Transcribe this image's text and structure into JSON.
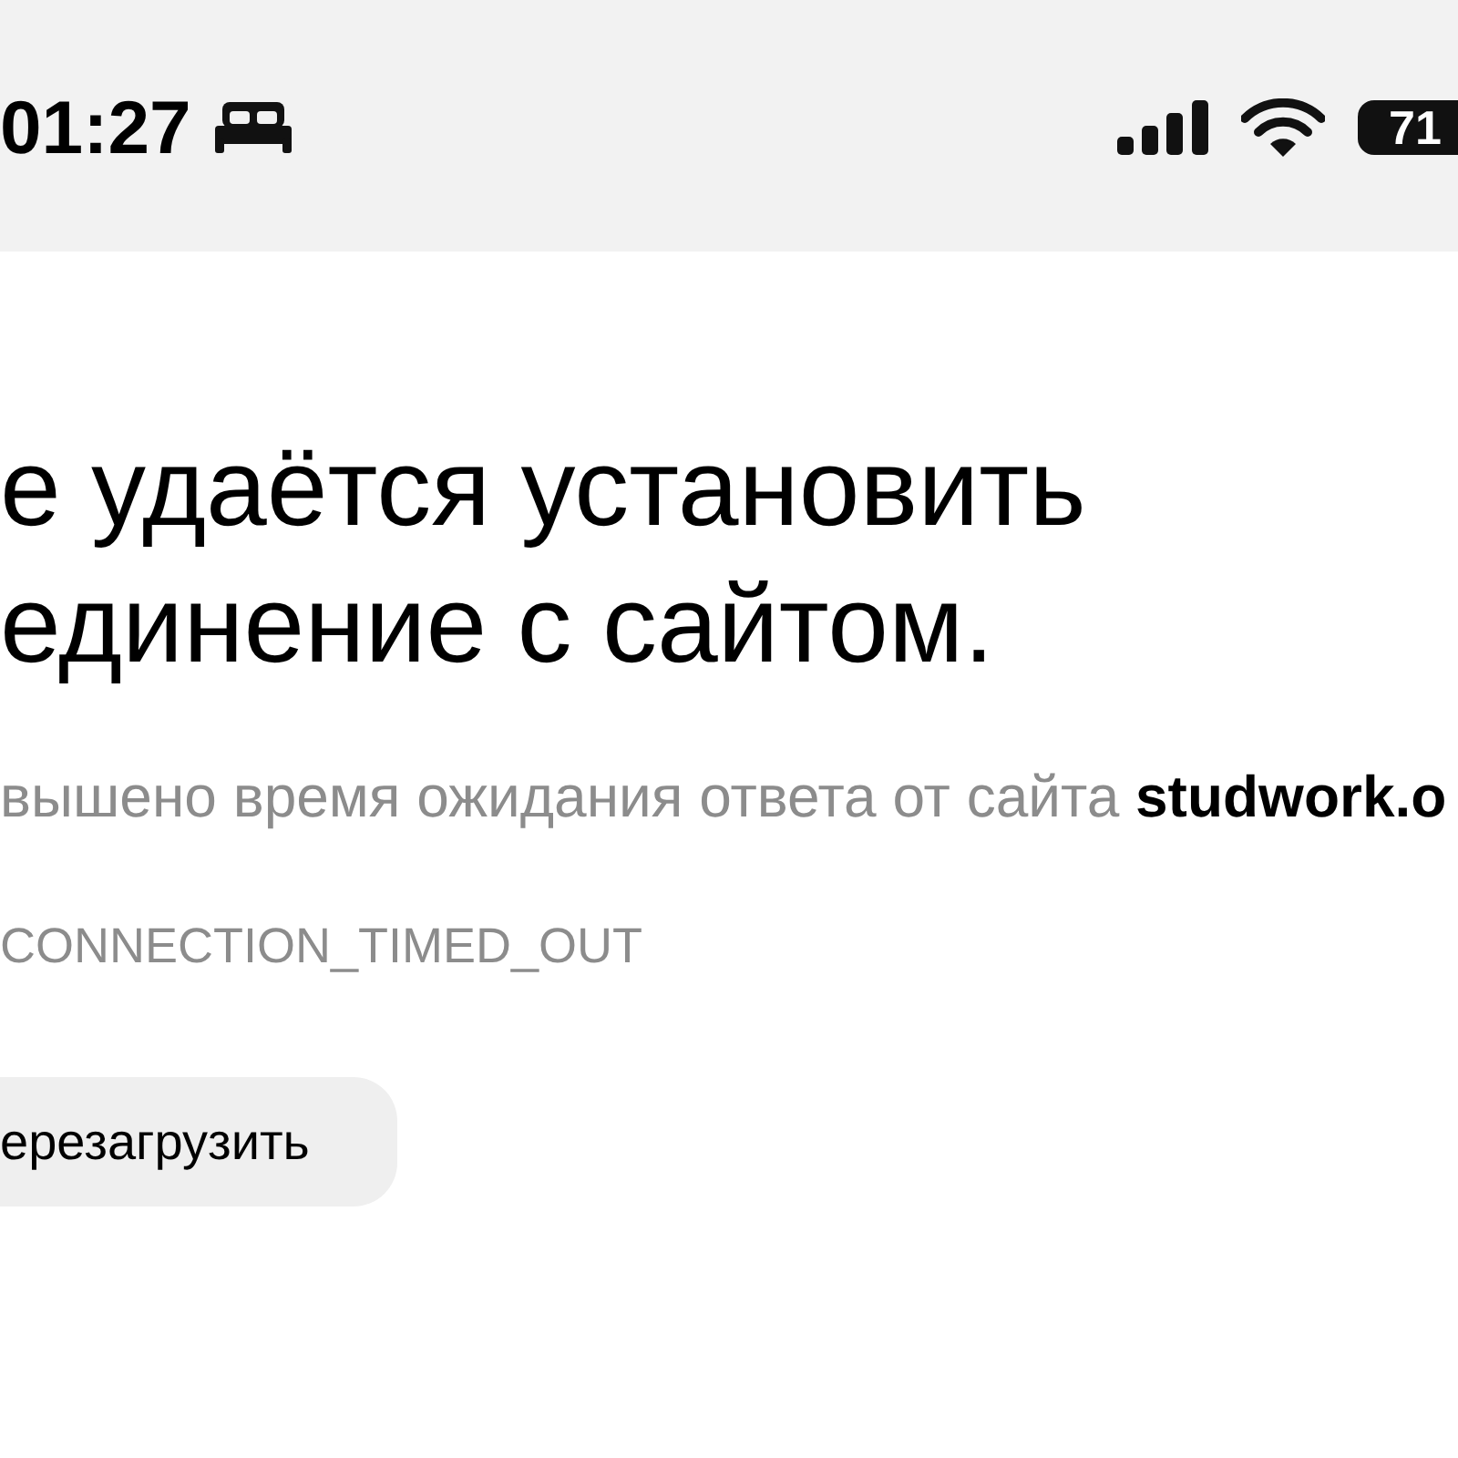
{
  "status_bar": {
    "time": "01:27",
    "battery": "71"
  },
  "error": {
    "title_lines": [
      "е удаётся установить",
      "единение с сайтом."
    ],
    "message": "вышено время ожидания ответа от сайта **studwork.o**",
    "code": "CONNECTION_TIMED_OUT"
  },
  "button": {
    "label": "ерезагрузить"
  }
}
